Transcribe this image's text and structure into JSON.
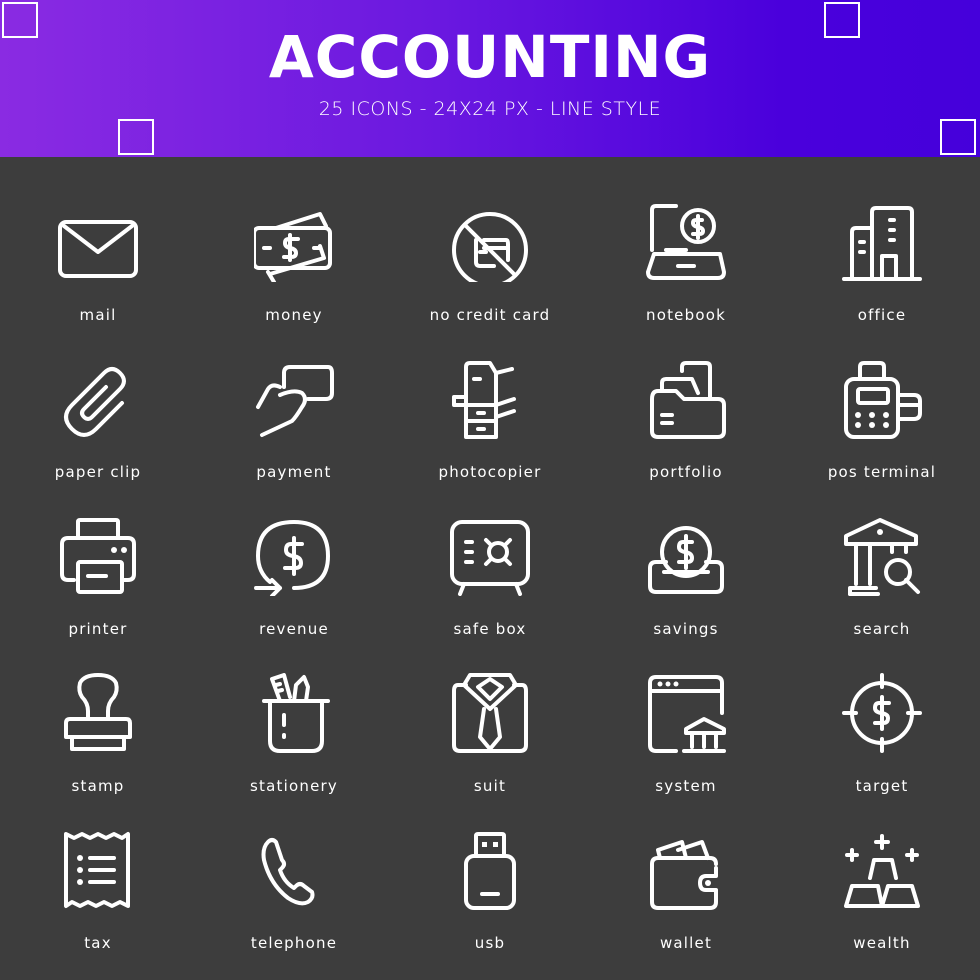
{
  "header": {
    "title": "ACCOUNTING",
    "subtitle": "25 ICONS - 24X24 PX - LINE STYLE",
    "gradient_start": "#8a2be2",
    "gradient_end": "#4500db"
  },
  "background_color": "#3d3d3d",
  "icons": [
    {
      "name": "mail",
      "icon": "mail-icon"
    },
    {
      "name": "money",
      "icon": "money-icon"
    },
    {
      "name": "no credit card",
      "icon": "no-credit-card-icon"
    },
    {
      "name": "notebook",
      "icon": "notebook-icon"
    },
    {
      "name": "office",
      "icon": "office-icon"
    },
    {
      "name": "paper clip",
      "icon": "paper-clip-icon"
    },
    {
      "name": "payment",
      "icon": "payment-icon"
    },
    {
      "name": "photocopier",
      "icon": "photocopier-icon"
    },
    {
      "name": "portfolio",
      "icon": "portfolio-icon"
    },
    {
      "name": "pos terminal",
      "icon": "pos-terminal-icon"
    },
    {
      "name": "printer",
      "icon": "printer-icon"
    },
    {
      "name": "revenue",
      "icon": "revenue-icon"
    },
    {
      "name": "safe box",
      "icon": "safe-box-icon"
    },
    {
      "name": "savings",
      "icon": "savings-icon"
    },
    {
      "name": "search",
      "icon": "search-icon"
    },
    {
      "name": "stamp",
      "icon": "stamp-icon"
    },
    {
      "name": "stationery",
      "icon": "stationery-icon"
    },
    {
      "name": "suit",
      "icon": "suit-icon"
    },
    {
      "name": "system",
      "icon": "system-icon"
    },
    {
      "name": "target",
      "icon": "target-icon"
    },
    {
      "name": "tax",
      "icon": "tax-icon"
    },
    {
      "name": "telephone",
      "icon": "telephone-icon"
    },
    {
      "name": "usb",
      "icon": "usb-icon"
    },
    {
      "name": "wallet",
      "icon": "wallet-icon"
    },
    {
      "name": "wealth",
      "icon": "wealth-icon"
    }
  ]
}
